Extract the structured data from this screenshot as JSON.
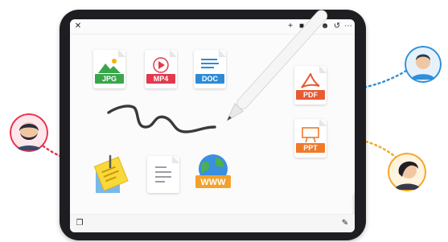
{
  "files": {
    "jpg": {
      "label": "JPG",
      "color": "#3aa64b"
    },
    "mp4": {
      "label": "MP4",
      "color": "#e03a4c"
    },
    "doc": {
      "label": "DOC",
      "color": "#2d8bd8"
    },
    "pdf": {
      "label": "PDF",
      "color": "#e85a34"
    },
    "ppt": {
      "label": "PPT",
      "color": "#f07a2a"
    },
    "www": {
      "label": "WWW"
    }
  },
  "palette": {
    "colors": [
      "#111111",
      "#ffffff",
      "#f5e33a",
      "#3ec24a",
      "#1e6fe0",
      "#e02a2a"
    ]
  },
  "accent": {
    "left_link": "#e8334f",
    "top_right_link": "#2f8fd8",
    "bottom_right_link": "#f5a623"
  },
  "icons": [
    "close-icon",
    "plus-icon",
    "folder-icon",
    "users-icon",
    "undo-icon",
    "more-icon",
    "pencil-icon",
    "eraser-icon",
    "copy-icon"
  ]
}
